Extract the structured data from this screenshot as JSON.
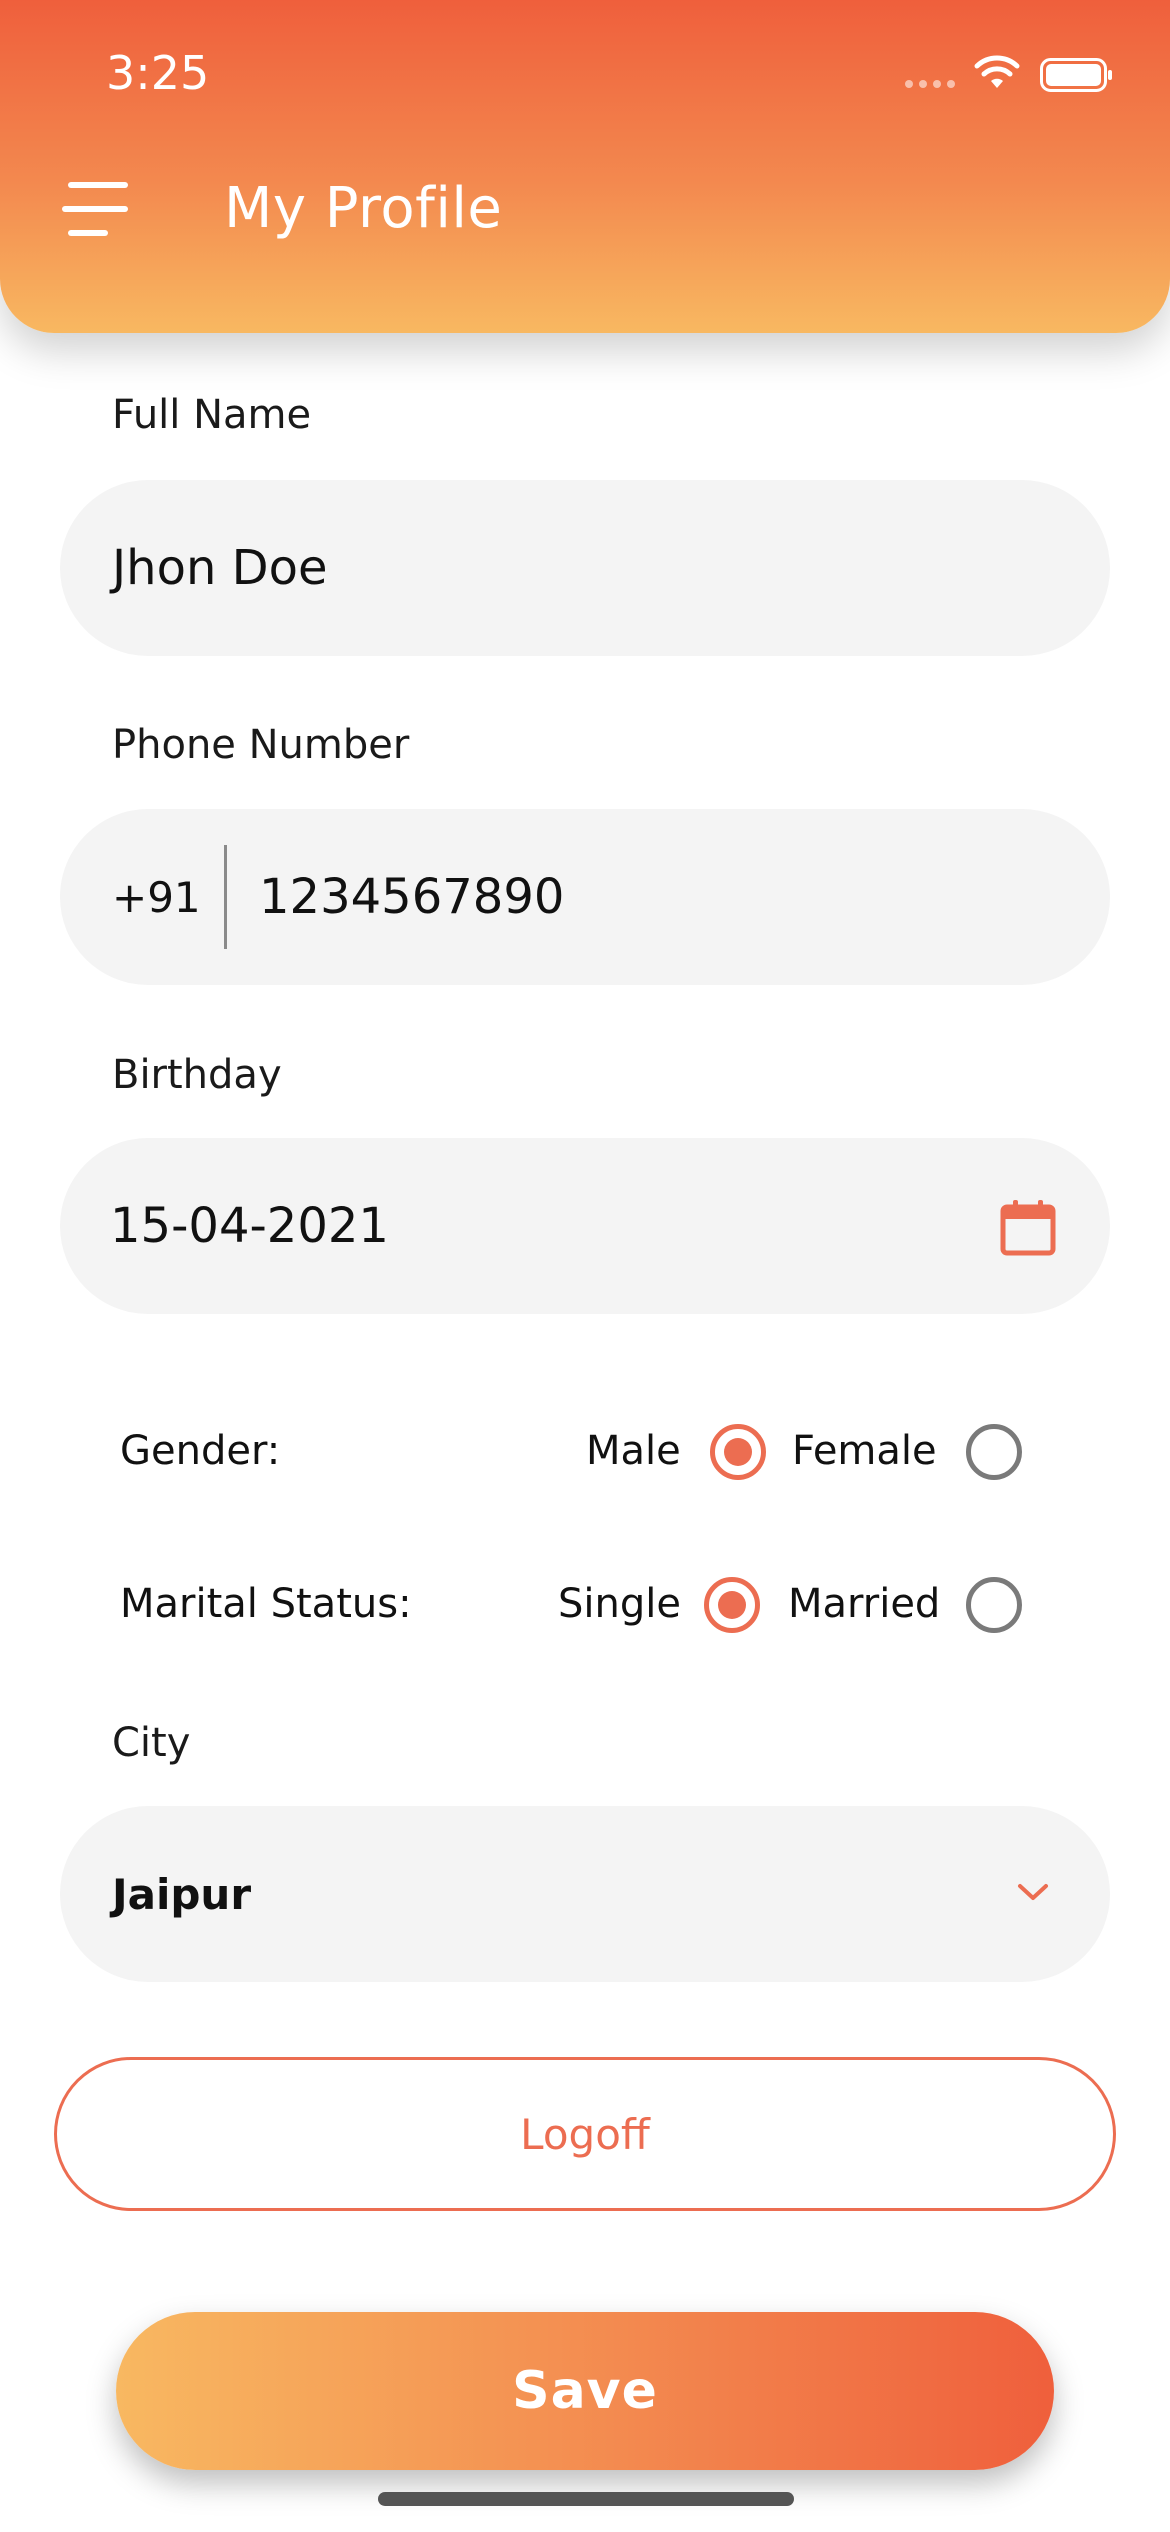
{
  "status_bar": {
    "time": "3:25"
  },
  "header": {
    "title": "My Profile"
  },
  "form": {
    "full_name": {
      "label": "Full Name",
      "value": "Jhon Doe"
    },
    "phone": {
      "label": "Phone Number",
      "prefix": "+91",
      "value": "1234567890"
    },
    "birthday": {
      "label": "Birthday",
      "value": "15-04-2021"
    },
    "gender": {
      "label": "Gender:",
      "options": [
        "Male",
        "Female"
      ],
      "selected": "Male"
    },
    "marital_status": {
      "label": "Marital Status:",
      "options": [
        "Single",
        "Married"
      ],
      "selected": "Single"
    },
    "city": {
      "label": "City",
      "value": "Jaipur"
    }
  },
  "buttons": {
    "logoff": "Logoff",
    "save": "Save"
  },
  "colors": {
    "accent": "#EC6D51",
    "gradient_start": "#EF5F3C",
    "gradient_end": "#F8B861",
    "field_bg": "#F4F4F4"
  },
  "icons": [
    "menu-icon",
    "wifi-icon",
    "battery-icon",
    "calendar-icon",
    "chevron-down-icon"
  ]
}
